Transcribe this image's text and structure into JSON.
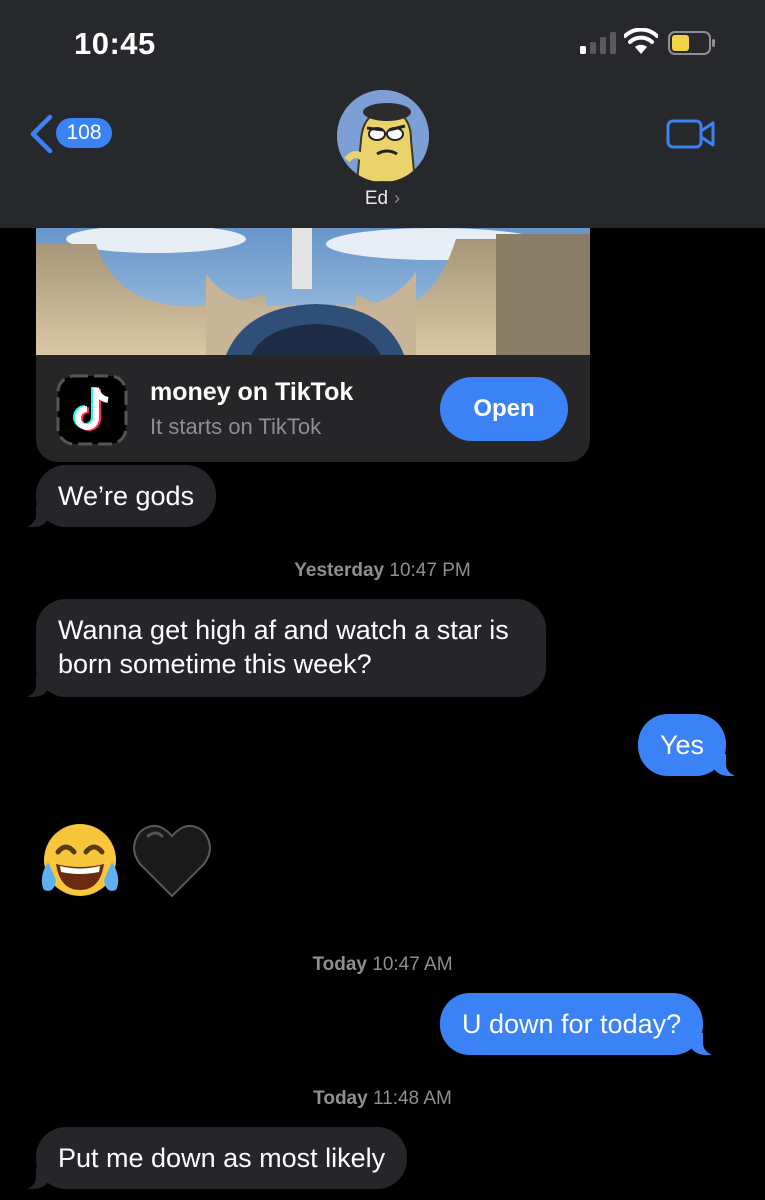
{
  "status_bar": {
    "time": "10:45"
  },
  "header": {
    "back_count": "108",
    "contact_name": "Ed",
    "chevron": "›",
    "video_icon": "video-camera-icon"
  },
  "link_preview": {
    "title": "money on TikTok",
    "subtitle": "It starts on TikTok",
    "button": "Open",
    "app_icon": "tiktok-icon"
  },
  "messages": [
    {
      "direction": "incoming",
      "text": "We’re gods"
    },
    {
      "timestamp_day": "Yesterday",
      "timestamp_time": "10:47 PM"
    },
    {
      "direction": "incoming",
      "line1": "Wanna get high af and watch a star is",
      "line2": "born sometime this week?"
    },
    {
      "direction": "outgoing",
      "text": "Yes"
    },
    {
      "direction": "incoming",
      "emoji": [
        "face-with-tears-of-joy",
        "black-heart"
      ]
    },
    {
      "timestamp_day": "Today",
      "timestamp_time": "10:47 AM"
    },
    {
      "direction": "outgoing",
      "text": "U down for today?"
    },
    {
      "timestamp_day": "Today",
      "timestamp_time": "11:48 AM"
    },
    {
      "direction": "incoming",
      "text": "Put me down as most likely"
    }
  ],
  "colors": {
    "accent": "#3a82f6",
    "incoming_bubble": "#26262a",
    "header": "#27282b",
    "timestamp": "#8e8e93"
  }
}
